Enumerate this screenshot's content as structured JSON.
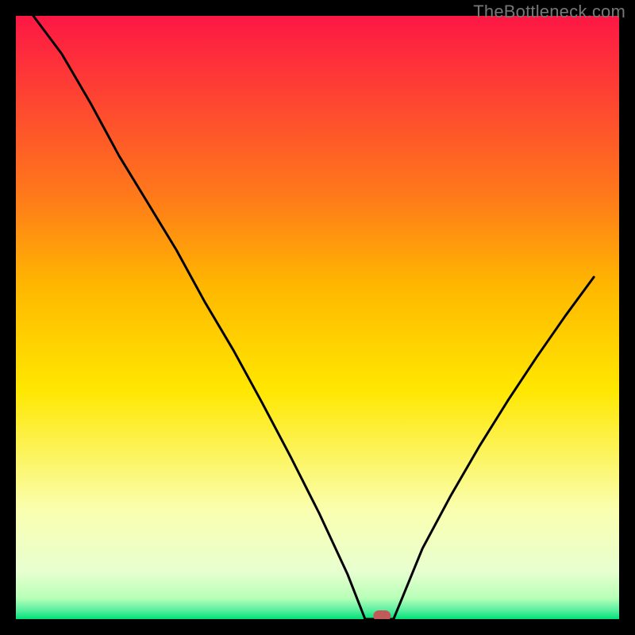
{
  "watermark": "TheBottleneck.com",
  "chart_data": {
    "type": "line",
    "title": "",
    "xlabel": "",
    "ylabel": "",
    "xlim": [
      0,
      100
    ],
    "ylim": [
      0,
      100
    ],
    "grid": false,
    "legend": false,
    "series": [
      {
        "name": "curve",
        "x": [
          2.9,
          7.6,
          12.4,
          17.1,
          21.8,
          26.6,
          31.3,
          36.1,
          40.8,
          45.5,
          50.3,
          55.0,
          57.9,
          62.6,
          67.4,
          72.1,
          76.8,
          81.6,
          86.3,
          91.1,
          95.8
        ],
        "y": [
          100.0,
          93.7,
          85.5,
          76.8,
          69.1,
          61.2,
          52.6,
          44.5,
          35.9,
          27.0,
          17.5,
          7.4,
          0.0,
          0.0,
          11.7,
          20.5,
          28.6,
          36.3,
          43.4,
          50.3,
          56.7
        ]
      }
    ],
    "marker": {
      "name": "optimum-marker",
      "x": 60.7,
      "y": 0.0,
      "color": "#c25a5a"
    },
    "background_gradient": {
      "top": "#fd1745",
      "upper_mid": "#ffb800",
      "mid": "#ffe700",
      "lower_mid": "#faffb0",
      "near_bottom": "#b8ffb8",
      "bottom": "#00e076"
    }
  }
}
